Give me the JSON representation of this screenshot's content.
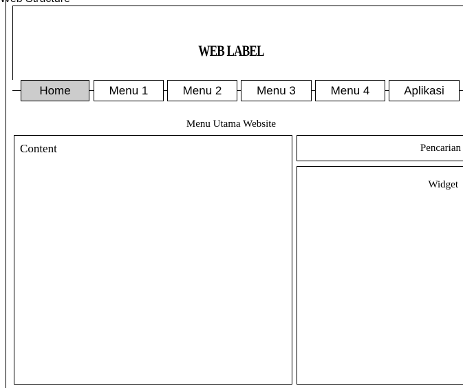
{
  "top_fragment": "Web Structure",
  "header": {
    "title": "WEB LABEL"
  },
  "menu": {
    "items": [
      {
        "label": "Home",
        "active": true
      },
      {
        "label": "Menu 1",
        "active": false
      },
      {
        "label": "Menu 2",
        "active": false
      },
      {
        "label": "Menu 3",
        "active": false
      },
      {
        "label": "Menu 4",
        "active": false
      },
      {
        "label": "Aplikasi",
        "active": false
      }
    ],
    "caption": "Menu Utama Website",
    "active_color": "#cccccc"
  },
  "main": {
    "content_label": "Content"
  },
  "sidebar": {
    "search_label": "Pencarian",
    "widget_label": "Widget"
  }
}
